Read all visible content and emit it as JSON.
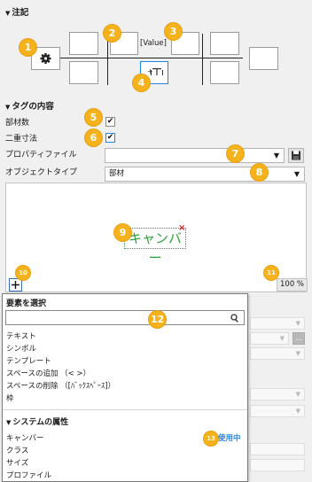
{
  "sections": {
    "annotation": "注記",
    "tag_content": "タグの内容",
    "system_attributes": "システムの属性"
  },
  "annotation_panel": {
    "value_label": "[Value]"
  },
  "tag": {
    "part_count_label": "部材数",
    "part_count_checked": "✔",
    "double_dim_label": "二重寸法",
    "double_dim_checked": "✔",
    "property_file_label": "プロパティファイル",
    "property_file_value": "",
    "object_type_label": "オブジェクトタイプ",
    "object_type_value": "部材"
  },
  "preview": {
    "tag_text": "キャンバー",
    "tag_color": "#2e9e3c",
    "zoom": "100 %"
  },
  "element_menu": {
    "title": "要素を選択",
    "search_placeholder": "",
    "items": [
      "テキスト",
      "シンボル",
      "テンプレート",
      "スペースの追加 （< >）",
      "スペースの削除 （[ﾊﾞｯｸｽﾍﾟｰｽ]）",
      "枠"
    ],
    "system_items": [
      "キャンバー",
      "クラス",
      "サイズ",
      "プロファイル"
    ],
    "in_use_label": "使用中",
    "in_use_color": "#1e88e5"
  },
  "badges": [
    "1",
    "2",
    "3",
    "4",
    "5",
    "6",
    "7",
    "8",
    "9",
    "10",
    "11",
    "12",
    "13"
  ],
  "icons": {
    "gear": "gear-icon",
    "add_text": "add-text-icon",
    "save": "save-icon",
    "plus": "plus-icon",
    "search": "search-icon",
    "delete": "delete-x-icon"
  },
  "accent_color": "#f6b21c"
}
